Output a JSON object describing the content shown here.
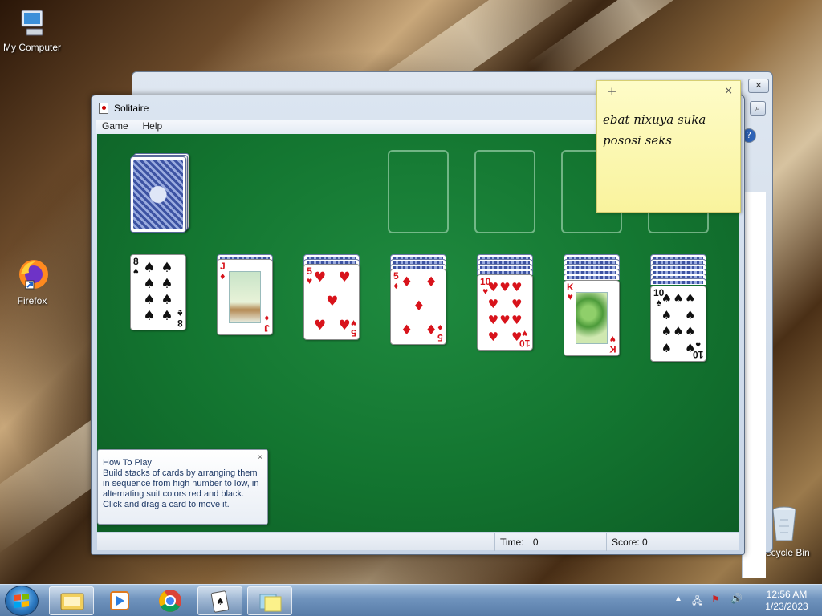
{
  "desktop": {
    "icons": [
      {
        "label": "My Computer",
        "icon": "computer-icon"
      },
      {
        "label": "Firefox",
        "icon": "firefox-icon"
      },
      {
        "label": "Recycle Bin",
        "icon": "recycle-bin-icon"
      }
    ]
  },
  "solitaire": {
    "title": "Solitaire",
    "menu": [
      "Game",
      "Help"
    ],
    "status": {
      "time_label": "Time:",
      "time_value": "0",
      "score_label": "Score:",
      "score_value": "0"
    },
    "tableau": [
      {
        "rank": "8",
        "suit": "♠",
        "color": "black"
      },
      {
        "rank": "J",
        "suit": "♦",
        "color": "red"
      },
      {
        "rank": "5",
        "suit": "♥",
        "color": "red"
      },
      {
        "rank": "5",
        "suit": "♦",
        "color": "red"
      },
      {
        "rank": "10",
        "suit": "♥",
        "color": "red"
      },
      {
        "rank": "K",
        "suit": "♥",
        "color": "red"
      },
      {
        "rank": "10",
        "suit": "♠",
        "color": "black"
      }
    ]
  },
  "howto": {
    "title": "How To Play",
    "body": "Build stacks of cards by arranging them in sequence from high number to low, in alternating suit colors red and black. Click and drag a card to move it.",
    "close": "×"
  },
  "sticky": {
    "add": "+",
    "close": "×",
    "text": "ebat nixuya suka\npososi seks"
  },
  "taskbar": {
    "apps": [
      "explorer-icon",
      "media-player-icon",
      "chrome-icon",
      "solitaire-icon",
      "sticky-notes-icon"
    ],
    "clock_time": "12:56 AM",
    "clock_date": "1/23/2023"
  }
}
